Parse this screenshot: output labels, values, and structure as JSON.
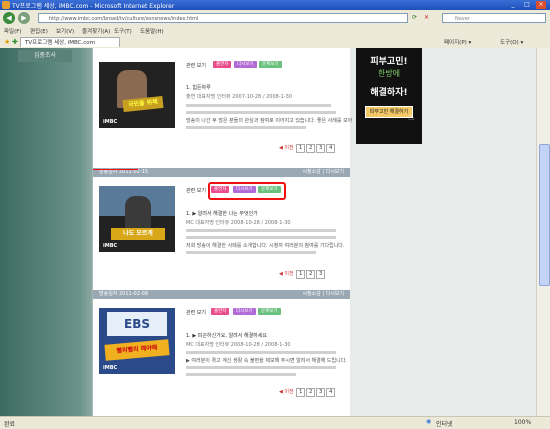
{
  "window": {
    "title": "TV프로그램 세상, iMBC.com - Microsoft Internet Explorer"
  },
  "address": {
    "url": "http://www.imbc.com/broad/tv/culture/sonsnews/index.html",
    "search_placeholder": "Naver"
  },
  "menu": [
    "파일(F)",
    "편집(E)",
    "보기(V)",
    "즐겨찾기(A)",
    "도구(T)",
    "도움말(H)"
  ],
  "tab": {
    "label": "TV프로그램 세상, iMBC.com"
  },
  "toolbar": {
    "page_label": "페이지(P) ▾",
    "tools_label": "도구(O) ▾"
  },
  "sidebar": {
    "button_label": "심층조사"
  },
  "cards": [
    {
      "tags": [
        "관련 보기",
        "출연자",
        "다시보기",
        "문제보기"
      ],
      "title": "1. 힘든하루",
      "meta": "출연 대표자명 인터뷰 2007-10-28 / 2008-1-30",
      "desc": "방송이 나간 후 많은 분들의 관심과 참여로 이어지고 있습니다. 좋은 사례를 모아",
      "pager": [
        "1",
        "2",
        "3",
        "4"
      ]
    },
    {
      "date": "방송일자 2011-02-15",
      "right": "시청소감 | 다시보기",
      "tags": [
        "관련 보기",
        "출연자",
        "다시보기",
        "문제보기"
      ],
      "title": "1. ▶ 알려서 해결한 나는 무엇인가",
      "meta": "MC 대표자명 인터뷰 2008-10-28 / 2008-1-30",
      "desc": "저희 방송이 해결한 사례를 소개합니다. 시청자 여러분의 참여를 기다립니다.",
      "pager": [
        "1",
        "2",
        "3"
      ]
    },
    {
      "date": "방송일자 2011-02-08",
      "right": "시청소감 | 다시보기",
      "tags": [
        "관련 보기",
        "출연자",
        "다시보기",
        "문제보기"
      ],
      "title": "1. ▶ 피곤하신가요, 알려서 해결하세요",
      "meta": "MC 대표자명 인터뷰 2008-10-28 / 2008-1-30",
      "desc": "▶ 여러분이 겪고 계신 생활 속 불편을 제보해 주시면 알려서 해결해 드립니다.",
      "pager": [
        "1",
        "2",
        "3",
        "4"
      ]
    }
  ],
  "ad": {
    "line1": "피부고민!",
    "line2": "한방에",
    "line3": "해결하자!",
    "button": "피부고민 해결하기"
  },
  "status": {
    "left": "완료",
    "zone": "인터넷",
    "zoom": "100%"
  }
}
